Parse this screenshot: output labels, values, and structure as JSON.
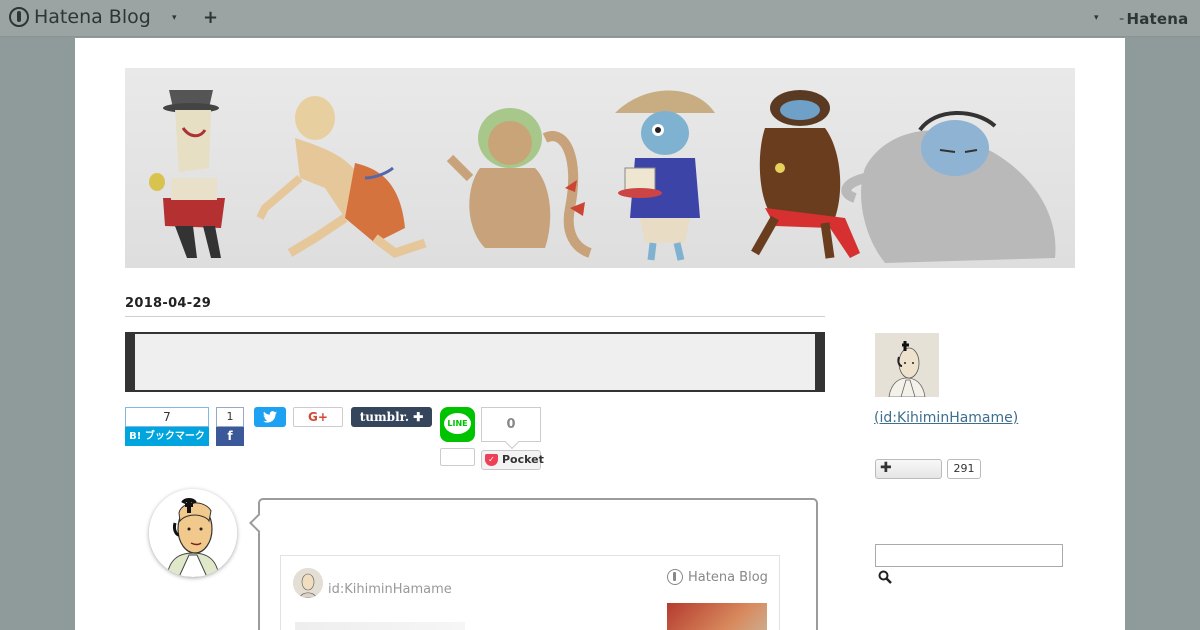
{
  "topbar": {
    "brand": "Hatena Blog",
    "caret": "▾",
    "add": "+",
    "right_caret": "▾",
    "hatena": "Hatena"
  },
  "entry": {
    "date": "2018-04-29"
  },
  "share": {
    "hatebu_count": "7",
    "hatebu_label": "B! ブックマーク",
    "facebook_count": "1",
    "facebook_label": "f",
    "twitter_label": "🐦",
    "gplus_label": "G+",
    "tumblr_label": "tumblr. ✚",
    "line_label": "LINE",
    "pocket_count": "0",
    "pocket_label": "Pocket"
  },
  "embed": {
    "user": "id:KihiminHamame",
    "brand": "Hatena Blog"
  },
  "sidebar": {
    "profile_id": " (id:KihiminHamame)",
    "follow_label": "✚",
    "follow_count": "291",
    "search_placeholder": ""
  },
  "colors": {
    "topbar": "#9ba3a3",
    "background": "#8f9a9a",
    "hatebu": "#00a4de",
    "facebook": "#3b5998",
    "twitter": "#1da1f2",
    "tumblr": "#35465c",
    "line": "#00c300",
    "pocket": "#ee4056",
    "link": "#3d6f8e"
  }
}
